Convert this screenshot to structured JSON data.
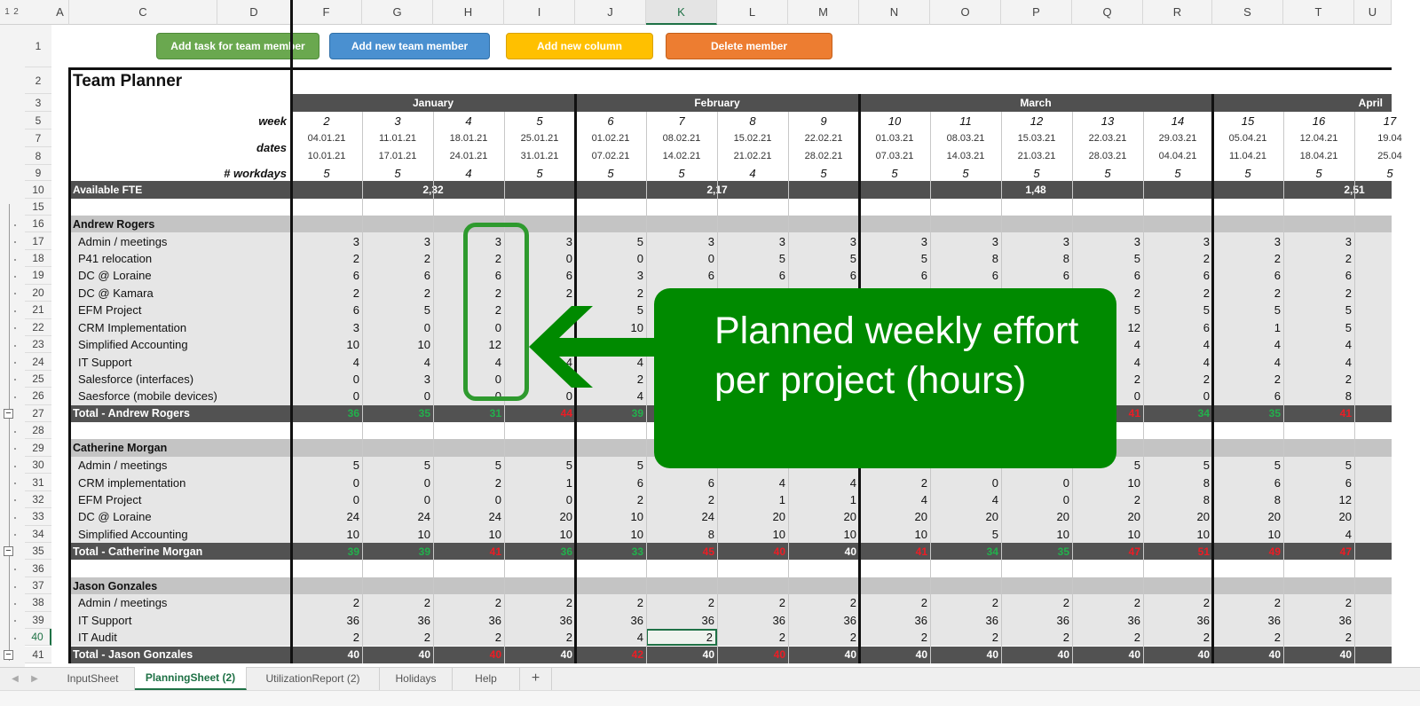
{
  "toolbar": {
    "buttons": [
      {
        "label": "Add task for team member",
        "color": "#6aa84f",
        "border": "#4f8a3a"
      },
      {
        "label": "Add new team member",
        "color": "#4a90d0",
        "border": "#2f6fa8"
      },
      {
        "label": "Add new column",
        "color": "#ffc000",
        "border": "#d9a200"
      },
      {
        "label": "Delete member",
        "color": "#ed7d31",
        "border": "#c35f1a"
      }
    ]
  },
  "outline_levels": [
    "1",
    "2"
  ],
  "column_headers": [
    "A",
    "C",
    "D",
    "F",
    "G",
    "H",
    "I",
    "J",
    "K",
    "L",
    "M",
    "N",
    "O",
    "P",
    "Q",
    "R",
    "S",
    "T",
    "U"
  ],
  "selected_column": "K",
  "row_numbers": [
    "1",
    "2",
    "3",
    "5",
    "7",
    "8",
    "9",
    "10",
    "15",
    "16",
    "17",
    "18",
    "19",
    "20",
    "21",
    "22",
    "23",
    "24",
    "25",
    "26",
    "27",
    "28",
    "29",
    "30",
    "31",
    "32",
    "33",
    "34",
    "35",
    "36",
    "37",
    "38",
    "39",
    "40",
    "41"
  ],
  "selected_row": "40",
  "sheet": {
    "title": "Team Planner",
    "labels": {
      "week": "week",
      "dates": "dates",
      "workdays": "# workdays",
      "available_fte": "Available FTE"
    },
    "months": [
      {
        "name": "January",
        "fte": "2,32"
      },
      {
        "name": "February",
        "fte": "2,17"
      },
      {
        "name": "March",
        "fte": "1,48"
      },
      {
        "name": "April",
        "fte": "2,51"
      }
    ],
    "weeks": [
      "2",
      "3",
      "4",
      "5",
      "6",
      "7",
      "8",
      "9",
      "10",
      "11",
      "12",
      "13",
      "14",
      "15",
      "16",
      "17"
    ],
    "start_dates": [
      "04.01.21",
      "11.01.21",
      "18.01.21",
      "25.01.21",
      "01.02.21",
      "08.02.21",
      "15.02.21",
      "22.02.21",
      "01.03.21",
      "08.03.21",
      "15.03.21",
      "22.03.21",
      "29.03.21",
      "05.04.21",
      "12.04.21",
      "19.04"
    ],
    "end_dates": [
      "10.01.21",
      "17.01.21",
      "24.01.21",
      "31.01.21",
      "07.02.21",
      "14.02.21",
      "21.02.21",
      "28.02.21",
      "07.03.21",
      "14.03.21",
      "21.03.21",
      "28.03.21",
      "04.04.21",
      "11.04.21",
      "18.04.21",
      "25.04"
    ],
    "workdays": [
      "5",
      "5",
      "4",
      "5",
      "5",
      "5",
      "4",
      "5",
      "5",
      "5",
      "5",
      "5",
      "5",
      "5",
      "5",
      "5"
    ]
  },
  "members": [
    {
      "name": "Andrew Rogers",
      "tasks": [
        {
          "name": "Admin / meetings",
          "values": [
            "3",
            "3",
            "3",
            "3",
            "5",
            "3",
            "3",
            "3",
            "3",
            "3",
            "3",
            "3",
            "3",
            "3",
            "3"
          ]
        },
        {
          "name": "P41 relocation",
          "values": [
            "2",
            "2",
            "2",
            "0",
            "0",
            "0",
            "5",
            "5",
            "5",
            "8",
            "8",
            "5",
            "2",
            "2",
            "2"
          ]
        },
        {
          "name": "DC @ Loraine",
          "values": [
            "6",
            "6",
            "6",
            "6",
            "3",
            "6",
            "6",
            "6",
            "6",
            "6",
            "6",
            "6",
            "6",
            "6",
            "6"
          ]
        },
        {
          "name": "DC @ Kamara",
          "values": [
            "2",
            "2",
            "2",
            "2",
            "2",
            "",
            "",
            "",
            "",
            "",
            "",
            "2",
            "2",
            "2",
            "2"
          ]
        },
        {
          "name": "EFM Project",
          "values": [
            "6",
            "5",
            "2",
            "",
            "5",
            "",
            "",
            "",
            "",
            "",
            "",
            "5",
            "5",
            "5",
            "5"
          ]
        },
        {
          "name": "CRM Implementation",
          "values": [
            "3",
            "0",
            "0",
            "",
            "10",
            "",
            "",
            "",
            "",
            "",
            "",
            "12",
            "6",
            "1",
            "5"
          ]
        },
        {
          "name": "Simplified Accounting",
          "values": [
            "10",
            "10",
            "12",
            "",
            "",
            "",
            "",
            "",
            "",
            "",
            "",
            "4",
            "4",
            "4",
            "4"
          ]
        },
        {
          "name": "IT Support",
          "values": [
            "4",
            "4",
            "4",
            "4",
            "4",
            "",
            "",
            "",
            "",
            "",
            "",
            "4",
            "4",
            "4",
            "4"
          ]
        },
        {
          "name": "Salesforce (interfaces)",
          "values": [
            "0",
            "3",
            "0",
            "",
            "2",
            "",
            "",
            "",
            "",
            "",
            "",
            "2",
            "2",
            "2",
            "2"
          ]
        },
        {
          "name": "Saesforce (mobile devices)",
          "values": [
            "0",
            "0",
            "0",
            "0",
            "4",
            "",
            "",
            "",
            "",
            "",
            "",
            "0",
            "0",
            "6",
            "8"
          ]
        }
      ],
      "total": {
        "label": "Total - Andrew Rogers",
        "values": [
          "36",
          "35",
          "31",
          "44",
          "39",
          "",
          "",
          "",
          "",
          "",
          "",
          "41",
          "34",
          "35",
          "41"
        ],
        "status": [
          "under",
          "under",
          "under",
          "over",
          "under",
          "",
          "",
          "",
          "",
          "",
          "",
          "over",
          "under",
          "under",
          "over"
        ]
      }
    },
    {
      "name": "Catherine Morgan",
      "tasks": [
        {
          "name": "Admin / meetings",
          "values": [
            "5",
            "5",
            "5",
            "5",
            "5",
            "",
            "",
            "",
            "",
            "",
            "",
            "5",
            "5",
            "5",
            "5"
          ]
        },
        {
          "name": "CRM implementation",
          "values": [
            "0",
            "0",
            "2",
            "1",
            "6",
            "6",
            "4",
            "4",
            "2",
            "0",
            "0",
            "10",
            "8",
            "6",
            "6"
          ]
        },
        {
          "name": "EFM Project",
          "values": [
            "0",
            "0",
            "0",
            "0",
            "2",
            "2",
            "1",
            "1",
            "4",
            "4",
            "0",
            "2",
            "8",
            "8",
            "12"
          ]
        },
        {
          "name": "DC @ Loraine",
          "values": [
            "24",
            "24",
            "24",
            "20",
            "10",
            "24",
            "20",
            "20",
            "20",
            "20",
            "20",
            "20",
            "20",
            "20",
            "20"
          ]
        },
        {
          "name": "Simplified Accounting",
          "values": [
            "10",
            "10",
            "10",
            "10",
            "10",
            "8",
            "10",
            "10",
            "10",
            "5",
            "10",
            "10",
            "10",
            "10",
            "4"
          ]
        }
      ],
      "total": {
        "label": "Total - Catherine Morgan",
        "values": [
          "39",
          "39",
          "41",
          "36",
          "33",
          "45",
          "40",
          "40",
          "41",
          "34",
          "35",
          "47",
          "51",
          "49",
          "47"
        ],
        "status": [
          "under",
          "under",
          "over",
          "under",
          "under",
          "over",
          "over",
          "full",
          "over",
          "under",
          "under",
          "over",
          "over",
          "over",
          "over"
        ]
      }
    },
    {
      "name": "Jason Gonzales",
      "tasks": [
        {
          "name": "Admin / meetings",
          "values": [
            "2",
            "2",
            "2",
            "2",
            "2",
            "2",
            "2",
            "2",
            "2",
            "2",
            "2",
            "2",
            "2",
            "2",
            "2"
          ]
        },
        {
          "name": "IT Support",
          "values": [
            "36",
            "36",
            "36",
            "36",
            "36",
            "36",
            "36",
            "36",
            "36",
            "36",
            "36",
            "36",
            "36",
            "36",
            "36"
          ]
        },
        {
          "name": "IT Audit",
          "values": [
            "2",
            "2",
            "2",
            "2",
            "4",
            "2",
            "2",
            "2",
            "2",
            "2",
            "2",
            "2",
            "2",
            "2",
            "2"
          ]
        }
      ],
      "total": {
        "label": "Total - Jason Gonzales",
        "values": [
          "40",
          "40",
          "40",
          "40",
          "42",
          "40",
          "40",
          "40",
          "40",
          "40",
          "40",
          "40",
          "40",
          "40",
          "40"
        ],
        "status": [
          "full",
          "full",
          "over",
          "full",
          "over",
          "full",
          "over",
          "full",
          "full",
          "full",
          "full",
          "full",
          "full",
          "full",
          "full"
        ]
      }
    }
  ],
  "status_colors": {
    "under": "#22b14c",
    "over": "#ee1c24",
    "full": "#ffffff"
  },
  "callout": {
    "text": "Planned weekly effort per project (hours)",
    "color": "#008a00"
  },
  "tabs": [
    {
      "label": "InputSheet",
      "active": false
    },
    {
      "label": "PlanningSheet (2)",
      "active": true
    },
    {
      "label": "UtilizationReport (2)",
      "active": false
    },
    {
      "label": "Holidays",
      "active": false
    },
    {
      "label": "Help",
      "active": false
    }
  ],
  "add_sheet_label": "+"
}
